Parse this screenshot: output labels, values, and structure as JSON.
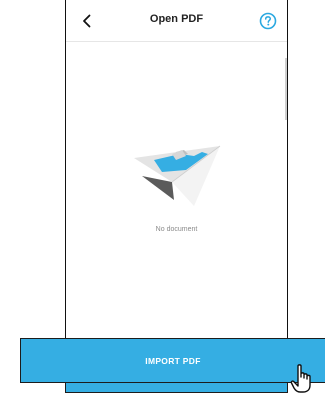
{
  "header": {
    "title": "Open PDF",
    "back_icon": "chevron-left-icon",
    "help_icon": "question-circle-icon"
  },
  "empty_state": {
    "illustration_icon": "paper-plane-icon",
    "message": "No document"
  },
  "import": {
    "label": "IMPORT PDF"
  },
  "cursor": {
    "icon": "hand-pointer-icon"
  },
  "colors": {
    "accent": "#35aee3",
    "help_icon": "#2aa8e0",
    "text_muted": "#8a8a8a",
    "border": "#1c1c1c"
  }
}
